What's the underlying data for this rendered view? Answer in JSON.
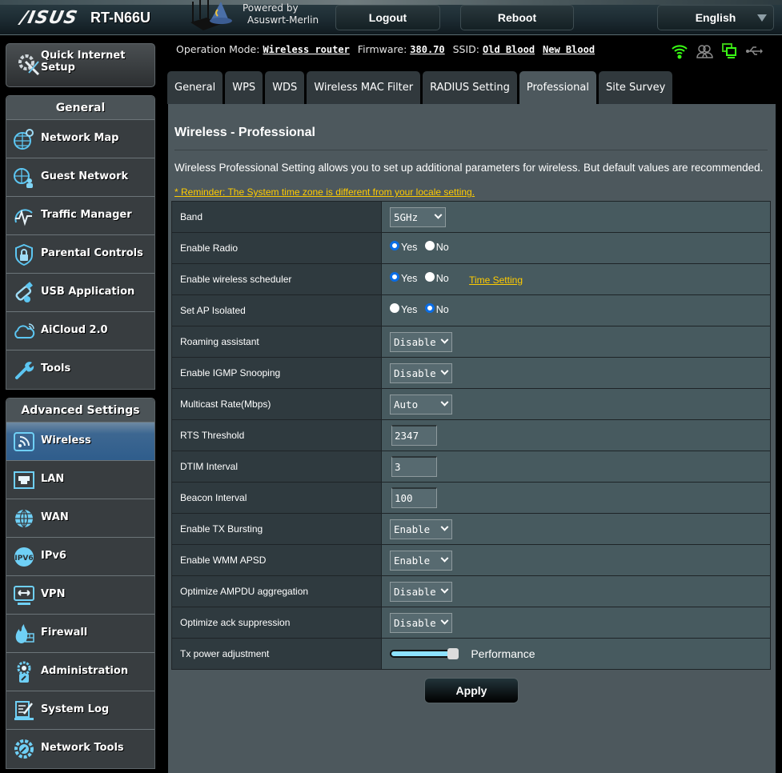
{
  "header": {
    "brand": "/ISUS",
    "model": "RT-N66U",
    "powered_by_line1": "Powered by",
    "powered_by_line2": "Asuswrt-Merlin",
    "logout_label": "Logout",
    "reboot_label": "Reboot",
    "language": "English"
  },
  "status": {
    "operation_mode_label": "Operation Mode:",
    "operation_mode_value": "Wireless router",
    "firmware_label": "Firmware:",
    "firmware_value": "380.70",
    "ssid_label": "SSID:",
    "ssid_1": "Old Blood",
    "ssid_2": "New Blood",
    "icons": [
      "wifi-icon",
      "clients-icon",
      "network-devices-icon",
      "usb-icon"
    ],
    "icon_colors": {
      "active": "#39ff14",
      "inactive": "#8a8a8a"
    }
  },
  "sidebar": {
    "quick_setup": {
      "line1": "Quick Internet",
      "line2": "Setup",
      "icon": "quick-setup-icon"
    },
    "general_header": "General",
    "general_items": [
      {
        "label": "Network Map",
        "icon": "network-map-icon"
      },
      {
        "label": "Guest Network",
        "icon": "guest-network-icon"
      },
      {
        "label": "Traffic Manager",
        "icon": "traffic-manager-icon"
      },
      {
        "label": "Parental Controls",
        "icon": "parental-controls-icon"
      },
      {
        "label": "USB Application",
        "icon": "usb-application-icon"
      },
      {
        "label": "AiCloud 2.0",
        "icon": "aicloud-icon"
      },
      {
        "label": "Tools",
        "icon": "tools-icon"
      }
    ],
    "advanced_header": "Advanced Settings",
    "advanced_items": [
      {
        "label": "Wireless",
        "icon": "wireless-icon",
        "active": true
      },
      {
        "label": "LAN",
        "icon": "lan-icon"
      },
      {
        "label": "WAN",
        "icon": "wan-icon"
      },
      {
        "label": "IPv6",
        "icon": "ipv6-icon"
      },
      {
        "label": "VPN",
        "icon": "vpn-icon"
      },
      {
        "label": "Firewall",
        "icon": "firewall-icon"
      },
      {
        "label": "Administration",
        "icon": "administration-icon"
      },
      {
        "label": "System Log",
        "icon": "system-log-icon"
      },
      {
        "label": "Network Tools",
        "icon": "network-tools-icon"
      }
    ]
  },
  "tabs": [
    {
      "label": "General"
    },
    {
      "label": "WPS"
    },
    {
      "label": "WDS"
    },
    {
      "label": "Wireless MAC Filter"
    },
    {
      "label": "RADIUS Setting"
    },
    {
      "label": "Professional",
      "active": true
    },
    {
      "label": "Site Survey"
    }
  ],
  "page": {
    "title": "Wireless - Professional",
    "description": "Wireless Professional Setting allows you to set up additional parameters for wireless. But default values are recommended.",
    "reminder": "* Reminder: The System time zone is different from your locale setting.",
    "apply_label": "Apply"
  },
  "settings": {
    "band": {
      "label": "Band",
      "value": "5GHz"
    },
    "enable_radio": {
      "label": "Enable Radio",
      "yes": "Yes",
      "no": "No",
      "selected": "Yes"
    },
    "wireless_scheduler": {
      "label": "Enable wireless scheduler",
      "yes": "Yes",
      "no": "No",
      "selected": "Yes",
      "link": "Time Setting"
    },
    "ap_isolated": {
      "label": "Set AP Isolated",
      "yes": "Yes",
      "no": "No",
      "selected": "No"
    },
    "roaming_assistant": {
      "label": "Roaming assistant",
      "value": "Disable"
    },
    "igmp_snooping": {
      "label": "Enable IGMP Snooping",
      "value": "Disable"
    },
    "multicast_rate": {
      "label": "Multicast Rate(Mbps)",
      "value": "Auto"
    },
    "rts_threshold": {
      "label": "RTS Threshold",
      "value": "2347"
    },
    "dtim_interval": {
      "label": "DTIM Interval",
      "value": "3"
    },
    "beacon_interval": {
      "label": "Beacon Interval",
      "value": "100"
    },
    "tx_bursting": {
      "label": "Enable TX Bursting",
      "value": "Enable"
    },
    "wmm_apsd": {
      "label": "Enable WMM APSD",
      "value": "Enable"
    },
    "ampdu_aggregation": {
      "label": "Optimize AMPDU aggregation",
      "value": "Disable"
    },
    "ack_suppression": {
      "label": "Optimize ack suppression",
      "value": "Disable"
    },
    "tx_power": {
      "label": "Tx power adjustment",
      "level_percent": 100,
      "level_label": "Performance"
    }
  }
}
